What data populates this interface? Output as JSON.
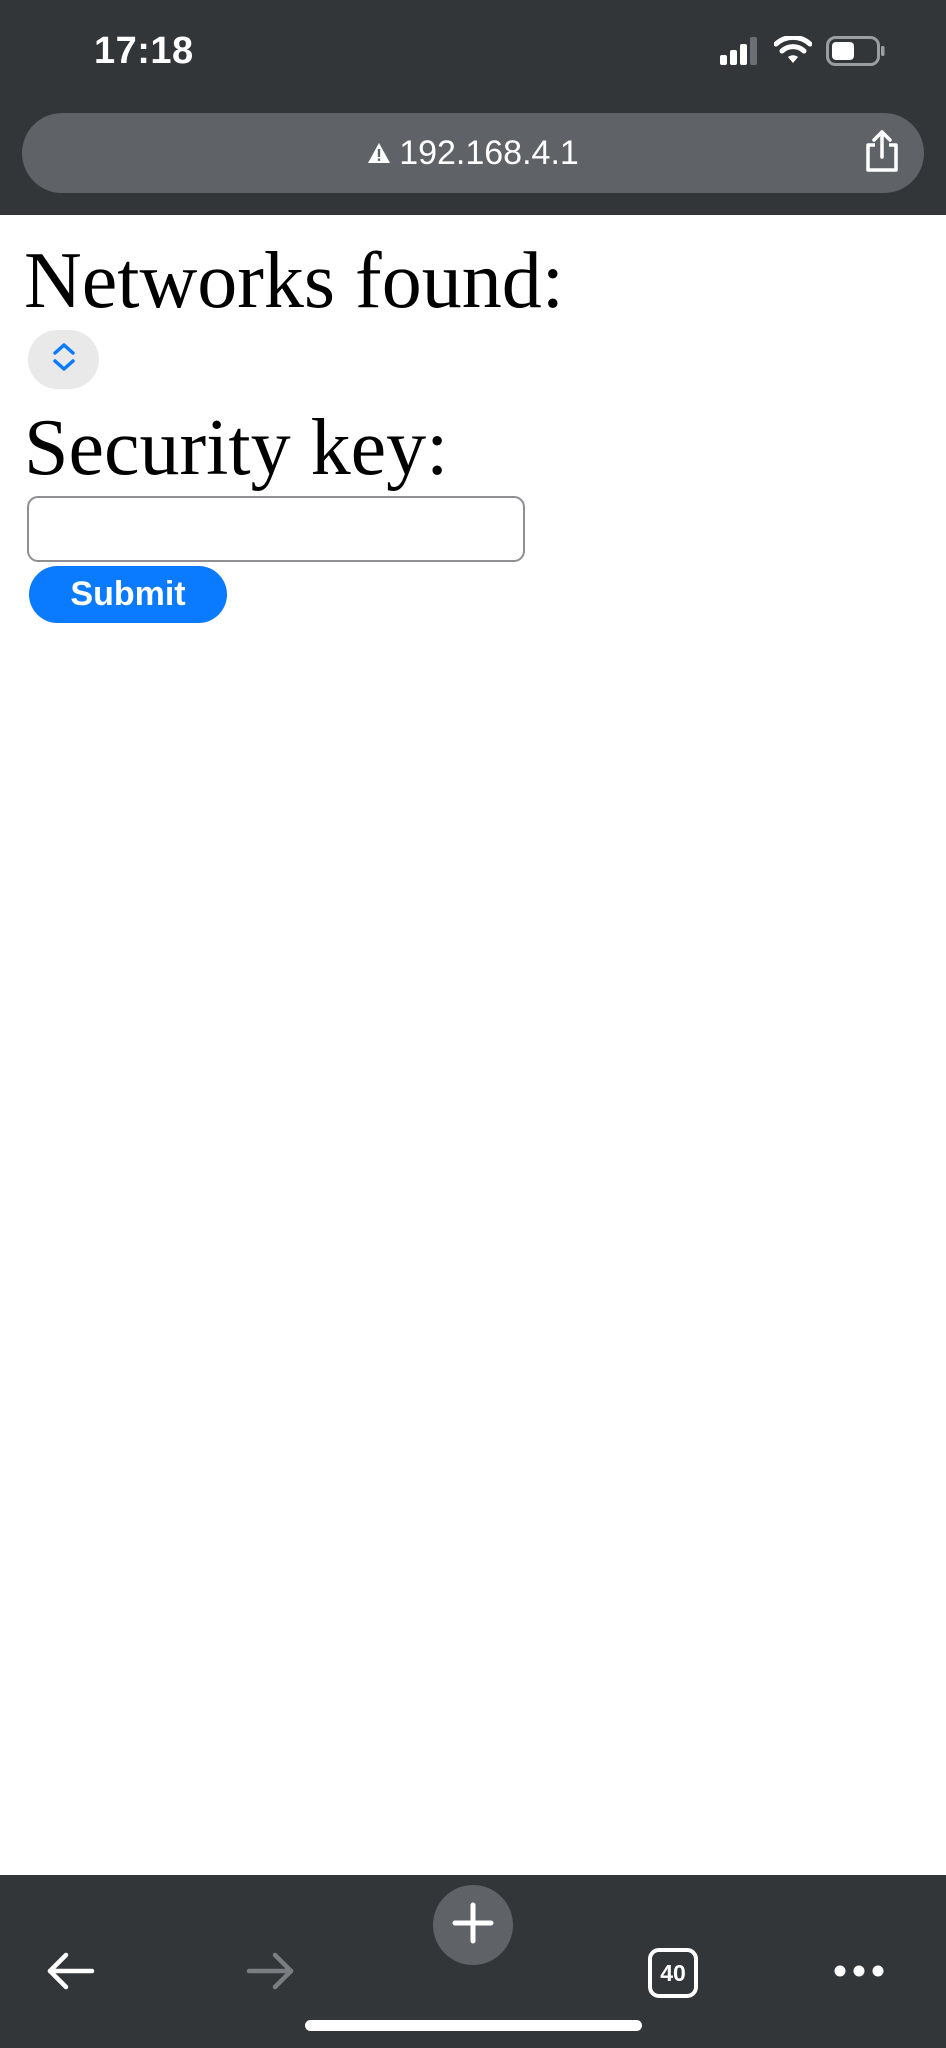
{
  "status_bar": {
    "time": "17:18",
    "icons": [
      "cellular-signal-icon",
      "wifi-icon",
      "battery-icon"
    ]
  },
  "address_bar": {
    "url": "192.168.4.1",
    "security_icon": "warning-icon",
    "share_icon": "share-icon"
  },
  "page": {
    "networks_heading": "Networks found:",
    "select_icon": "chevron-up-down-icon",
    "security_heading": "Security key:",
    "security_key_value": "",
    "submit_label": "Submit"
  },
  "toolbar": {
    "back_icon": "back-arrow-icon",
    "forward_icon": "forward-arrow-icon",
    "new_tab_icon": "plus-icon",
    "tab_count": "40",
    "menu_icon": "more-icon"
  },
  "colors": {
    "chrome_bg": "#333639",
    "address_bar_bg": "#5f6368",
    "accent": "#0a7aff",
    "select_bg": "#e9e9ea"
  }
}
